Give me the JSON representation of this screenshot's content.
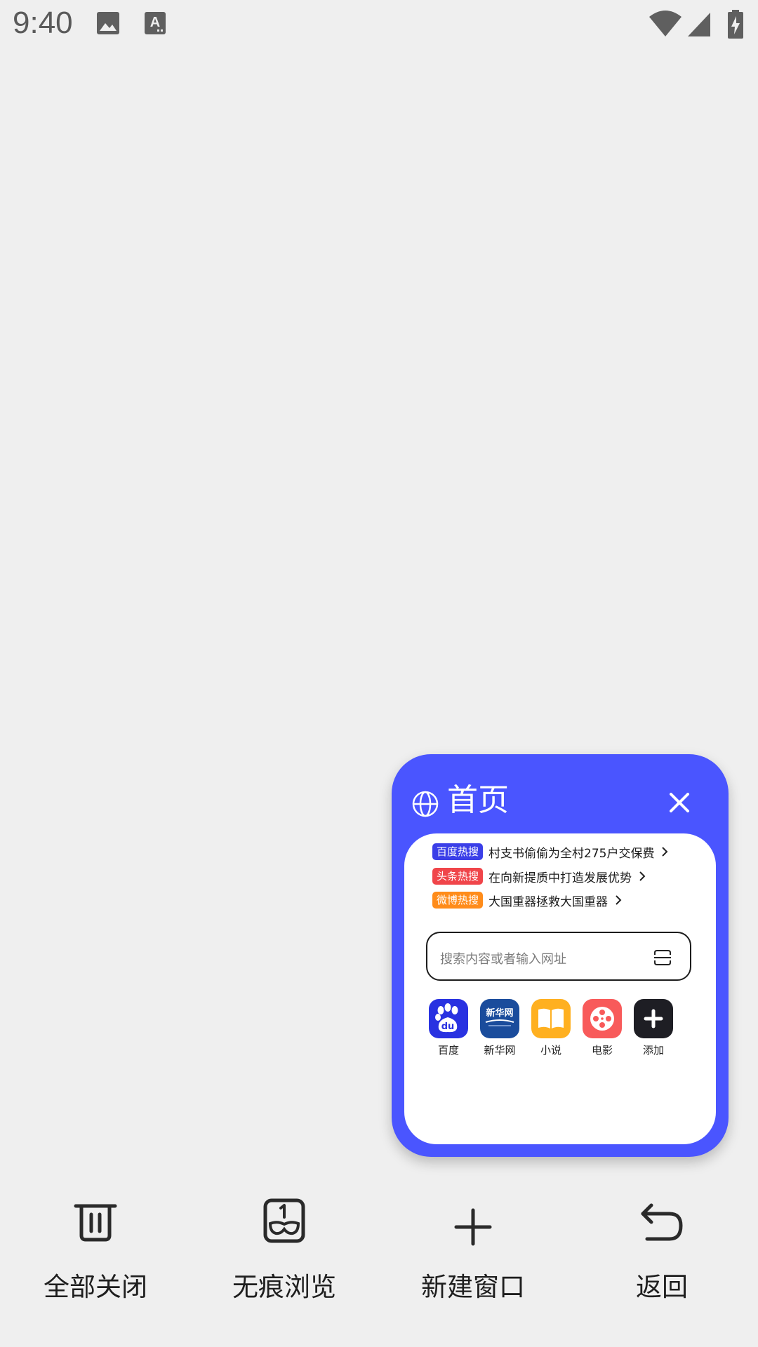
{
  "status_bar": {
    "time": "9:40",
    "icons": [
      "image-icon",
      "keyboard-a-icon",
      "wifi-icon",
      "cell-signal-icon",
      "battery-charging-icon"
    ]
  },
  "tab_card": {
    "title": "首页",
    "accent_color": "#4a55ff",
    "hot_searches": [
      {
        "badge": "百度热搜",
        "badge_color": "#3b3fe8",
        "text": "村支书偷偷为全村275户交保费"
      },
      {
        "badge": "头条热搜",
        "badge_color": "#f0454a",
        "text": "在向新提质中打造发展优势"
      },
      {
        "badge": "微博热搜",
        "badge_color": "#ff8c1a",
        "text": "大国重器拯救大国重器"
      }
    ],
    "search": {
      "placeholder": "搜索内容或者输入网址"
    },
    "shortcuts": [
      {
        "label": "百度",
        "icon": "baidu-icon",
        "color": "#2932e1"
      },
      {
        "label": "新华网",
        "icon": "xinhua-icon",
        "color": "#1a4c9c",
        "icon_text": "新华网"
      },
      {
        "label": "小说",
        "icon": "book-icon",
        "color": "#ffb020"
      },
      {
        "label": "电影",
        "icon": "film-reel-icon",
        "color": "#f85a5a"
      },
      {
        "label": "添加",
        "icon": "plus-icon",
        "color": "#1e1e24"
      }
    ]
  },
  "bottom_bar": {
    "close_all": "全部关闭",
    "incognito": "无痕浏览",
    "new_window": "新建窗口",
    "back": "返回"
  }
}
